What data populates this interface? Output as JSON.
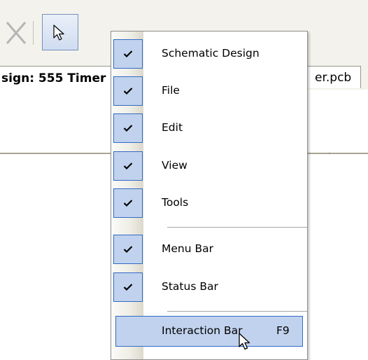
{
  "tabs": {
    "active_label": "sign: 555 Timer",
    "inactive_label": "er.pcb"
  },
  "toolbar": {
    "icons": [
      "delete-x-icon",
      "pointer-select-icon"
    ]
  },
  "context_menu": {
    "items": [
      {
        "label": "Schematic Design",
        "checked": true
      },
      {
        "label": "File",
        "checked": true
      },
      {
        "label": "Edit",
        "checked": true
      },
      {
        "label": "View",
        "checked": true
      },
      {
        "label": "Tools",
        "checked": true
      },
      {
        "label": "Menu Bar",
        "checked": true
      },
      {
        "label": "Status Bar",
        "checked": true
      },
      {
        "label": "Interaction Bar",
        "checked": false,
        "shortcut": "F9",
        "highlighted": true
      }
    ]
  },
  "colors": {
    "highlight_fill": "#c1d2ee",
    "highlight_border": "#316ac5",
    "toolbar_bg": "#f3f2ec"
  }
}
